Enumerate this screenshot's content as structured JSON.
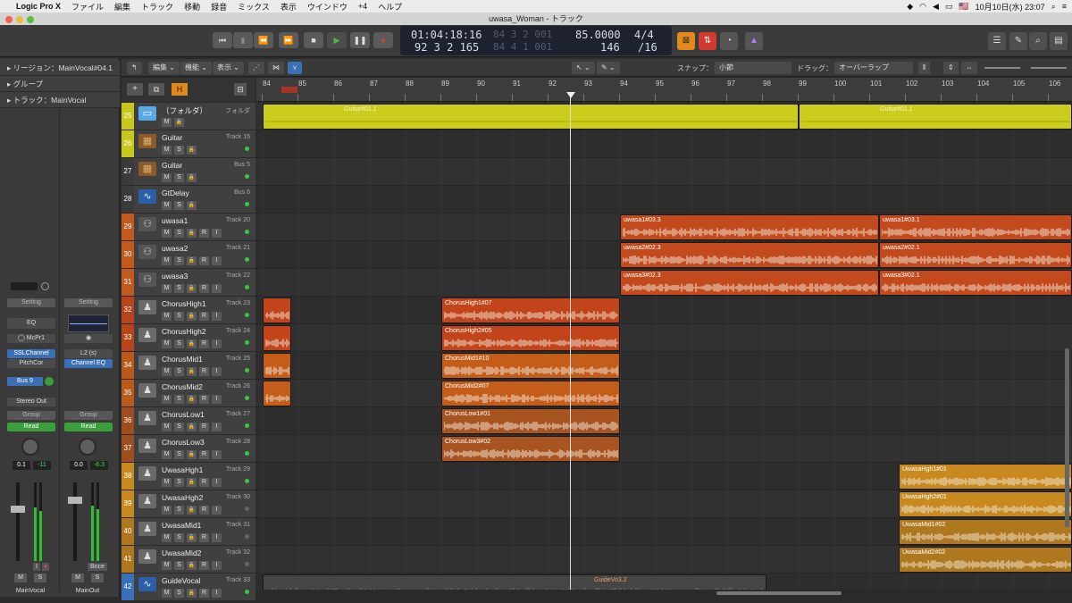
{
  "menubar": {
    "apple": "",
    "app": "Logic Pro X",
    "items": [
      "ファイル",
      "編集",
      "トラック",
      "移動",
      "録音",
      "ミックス",
      "表示",
      "ウインドウ",
      "+4",
      "ヘルプ"
    ],
    "flag": "🇺🇸",
    "clock": "10月10日(水) 23:07"
  },
  "window": {
    "title": "uwasa_Woman - トラック"
  },
  "transport": {
    "rewind_start": "⏮",
    "stop_btn": "▮",
    "rewind": "⏪",
    "forward": "⏩",
    "stop": "■",
    "play": "▶",
    "pause": "❚❚",
    "record": "●"
  },
  "lcd": {
    "smpte": "01:04:18:16",
    "bars": "92 3 2 165",
    "dim1": "84 3 2 001",
    "dim2": "84 4 1 001",
    "tempo": "85.0000",
    "key": "146",
    "sig_top": "4/4",
    "sig_bottom": "/16"
  },
  "inspector": {
    "region": "リージョン：MainVocal#04.1",
    "group": "グループ",
    "track": "トラック：MainVocal"
  },
  "strips": [
    {
      "setting": "Setting",
      "eq": "EQ",
      "plugin": "McPr1",
      "insert1": "SSLChannel",
      "insert2": "PitchCor",
      "send": "Bus 9",
      "output": "Stereo Out",
      "group": "Group",
      "auto": "Read",
      "pan": "0.1",
      "level": "-11",
      "name": "MainVocal",
      "m": "M",
      "s": "S"
    },
    {
      "setting": "Setting",
      "eq": "",
      "plugin": "L2 (s)",
      "insert1": "Channel EQ",
      "insert2": "",
      "send": "",
      "output": "",
      "group": "Group",
      "auto": "Read",
      "pan": "0.0",
      "level": "-6.3",
      "name": "MainOut",
      "m": "M",
      "s": "S",
      "bnce": "Bnce"
    }
  ],
  "toolbar2": {
    "edit": "編集",
    "function": "機能",
    "view": "表示",
    "snap_label": "スナップ：",
    "snap_value": "小節",
    "drag_label": "ドラッグ：",
    "drag_value": "オーバーラップ"
  },
  "ruler": {
    "bars": [
      "84",
      "85",
      "86",
      "87",
      "88",
      "89",
      "90",
      "91",
      "92",
      "93",
      "94",
      "95",
      "96",
      "97",
      "98",
      "99",
      "100",
      "101",
      "102",
      "103",
      "104",
      "105",
      "106"
    ]
  },
  "tracks": [
    {
      "num": "25",
      "name": "（フォルダ）",
      "sub": "フォルダ",
      "color": "#c8c81c",
      "icon": "folder-icon"
    },
    {
      "num": "26",
      "name": "Guitar",
      "sub": "Track 15",
      "color": "#c8c81c",
      "icon": "amp-icon"
    },
    {
      "num": "27",
      "name": "Guitar",
      "sub": "Bus 5",
      "color": "#3a3a3a",
      "icon": "amp-icon"
    },
    {
      "num": "28",
      "name": "GtDelay",
      "sub": "Bus 6",
      "color": "#3a3a3a",
      "icon": "waveform-icon"
    },
    {
      "num": "29",
      "name": "uwasa1",
      "sub": "Track 20",
      "color": "#c25a1e",
      "icon": "choir-icon"
    },
    {
      "num": "30",
      "name": "uwasa2",
      "sub": "Track 21",
      "color": "#c25a1e",
      "icon": "choir-icon"
    },
    {
      "num": "31",
      "name": "uwasa3",
      "sub": "Track 22",
      "color": "#c25a1e",
      "icon": "choir-icon"
    },
    {
      "num": "32",
      "name": "ChorusHigh1",
      "sub": "Track 23",
      "color": "#b8441a",
      "icon": "singer-icon"
    },
    {
      "num": "33",
      "name": "ChorusHigh2",
      "sub": "Track 24",
      "color": "#b8441a",
      "icon": "singer-icon"
    },
    {
      "num": "34",
      "name": "ChorusMid1",
      "sub": "Track 25",
      "color": "#b85a1a",
      "icon": "singer-icon"
    },
    {
      "num": "35",
      "name": "ChorusMid2",
      "sub": "Track 26",
      "color": "#b85a1a",
      "icon": "singer-icon"
    },
    {
      "num": "36",
      "name": "ChorusLow1",
      "sub": "Track 27",
      "color": "#9c4e1e",
      "icon": "singer-icon"
    },
    {
      "num": "37",
      "name": "ChorusLow3",
      "sub": "Track 28",
      "color": "#9c4e1e",
      "icon": "singer-icon"
    },
    {
      "num": "38",
      "name": "UwasaHgh1",
      "sub": "Track 29",
      "color": "#c88a1e",
      "icon": "singer-icon"
    },
    {
      "num": "39",
      "name": "UwasaHgh2",
      "sub": "Track 30",
      "color": "#c88a1e",
      "icon": "singer-icon"
    },
    {
      "num": "40",
      "name": "UwasaMid1",
      "sub": "Track 31",
      "color": "#b0781e",
      "icon": "singer-icon"
    },
    {
      "num": "41",
      "name": "UwasaMid2",
      "sub": "Track 32",
      "color": "#b0781e",
      "icon": "singer-icon"
    },
    {
      "num": "42",
      "name": "GuideVocal",
      "sub": "Track 33",
      "color": "#3a70b8",
      "icon": "waveform-icon"
    }
  ],
  "track_buttons": {
    "m": "M",
    "s": "S",
    "r": "R",
    "i": "I"
  },
  "regions": [
    {
      "lane": 0,
      "label": "Guitar#01.1",
      "start": 84,
      "end": 99,
      "color": "#cccc1c"
    },
    {
      "lane": 0,
      "label": "Guitar#01.1",
      "start": 99,
      "end": 106.8,
      "color": "#cccc1c"
    },
    {
      "lane": 4,
      "label": "uwasa1#03.3",
      "start": 94,
      "end": 101.25,
      "color": "#c24a1c"
    },
    {
      "lane": 4,
      "label": "uwasa1#03.1",
      "start": 101.25,
      "end": 106.8,
      "color": "#c24a1c"
    },
    {
      "lane": 5,
      "label": "uwasa2#02.3",
      "start": 94,
      "end": 101.25,
      "color": "#c24a1c"
    },
    {
      "lane": 5,
      "label": "uwasa2#02.1",
      "start": 101.25,
      "end": 106.8,
      "color": "#c24a1c"
    },
    {
      "lane": 6,
      "label": "uwasa3#02.3",
      "start": 94,
      "end": 101.25,
      "color": "#c24a1c"
    },
    {
      "lane": 6,
      "label": "uwasa3#02.1",
      "start": 101.25,
      "end": 106.8,
      "color": "#c24a1c"
    },
    {
      "lane": 7,
      "label": "",
      "start": 84,
      "end": 84.8,
      "color": "#c2441a"
    },
    {
      "lane": 7,
      "label": "ChorusHigh1#07",
      "start": 89,
      "end": 94,
      "color": "#c2441a"
    },
    {
      "lane": 8,
      "label": "",
      "start": 84,
      "end": 84.8,
      "color": "#c2441a"
    },
    {
      "lane": 8,
      "label": "ChorusHigh2#05",
      "start": 89,
      "end": 94,
      "color": "#c2441a"
    },
    {
      "lane": 9,
      "label": "",
      "start": 84,
      "end": 84.8,
      "color": "#c45c1a"
    },
    {
      "lane": 9,
      "label": "ChorusMid1#10",
      "start": 89,
      "end": 94,
      "color": "#c45c1a"
    },
    {
      "lane": 10,
      "label": "",
      "start": 84,
      "end": 84.8,
      "color": "#c45c1a"
    },
    {
      "lane": 10,
      "label": "ChorusMid2#07",
      "start": 89,
      "end": 94,
      "color": "#c45c1a"
    },
    {
      "lane": 11,
      "label": "ChorusLow1#01",
      "start": 89,
      "end": 94,
      "color": "#a85420"
    },
    {
      "lane": 12,
      "label": "ChorusLow3#02",
      "start": 89,
      "end": 94,
      "color": "#a85420"
    },
    {
      "lane": 13,
      "label": "UwasaHgh1#01",
      "start": 101.8,
      "end": 106.8,
      "color": "#c88a1e"
    },
    {
      "lane": 14,
      "label": "UwasaHgh2#01",
      "start": 101.8,
      "end": 106.8,
      "color": "#c88a1e"
    },
    {
      "lane": 15,
      "label": "UwasaMid1#02",
      "start": 101.8,
      "end": 106.8,
      "color": "#b0781e"
    },
    {
      "lane": 16,
      "label": "UwasaMid2#02",
      "start": 101.8,
      "end": 106.8,
      "color": "#b0781e"
    },
    {
      "lane": 17,
      "label": "GuideVo3.2",
      "start": 84,
      "end": 98.1,
      "color": "#454545"
    }
  ],
  "playhead_bar": 92.3
}
